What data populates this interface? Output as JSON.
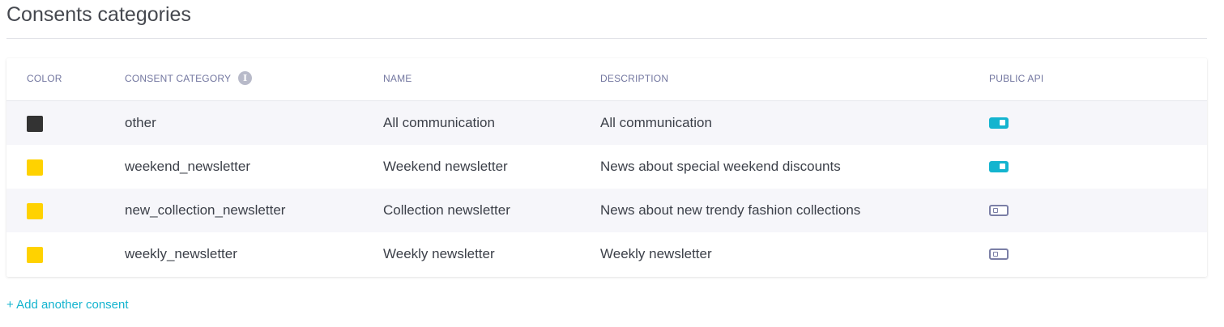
{
  "page": {
    "title": "Consents categories"
  },
  "table": {
    "headers": {
      "color": "COLOR",
      "consent_category": "CONSENT CATEGORY",
      "name": "NAME",
      "description": "DESCRIPTION",
      "public_api": "PUBLIC API"
    },
    "info_icon": "info-icon",
    "rows": [
      {
        "color": "#333333",
        "category": "other",
        "name": "All communication",
        "description": "All communication",
        "public_api": true
      },
      {
        "color": "#ffd200",
        "category": "weekend_newsletter",
        "name": "Weekend newsletter",
        "description": "News about special weekend discounts",
        "public_api": true
      },
      {
        "color": "#ffd200",
        "category": "new_collection_newsletter",
        "name": "Collection newsletter",
        "description": "News about new trendy fashion collections",
        "public_api": false
      },
      {
        "color": "#ffd200",
        "category": "weekly_newsletter",
        "name": "Weekly newsletter",
        "description": "Weekly newsletter",
        "public_api": false
      }
    ]
  },
  "actions": {
    "add_label": "+ Add another consent"
  },
  "colors": {
    "accent": "#14b4cf",
    "toggle_off": "#7b7fa6",
    "header_text": "#7377a0"
  }
}
